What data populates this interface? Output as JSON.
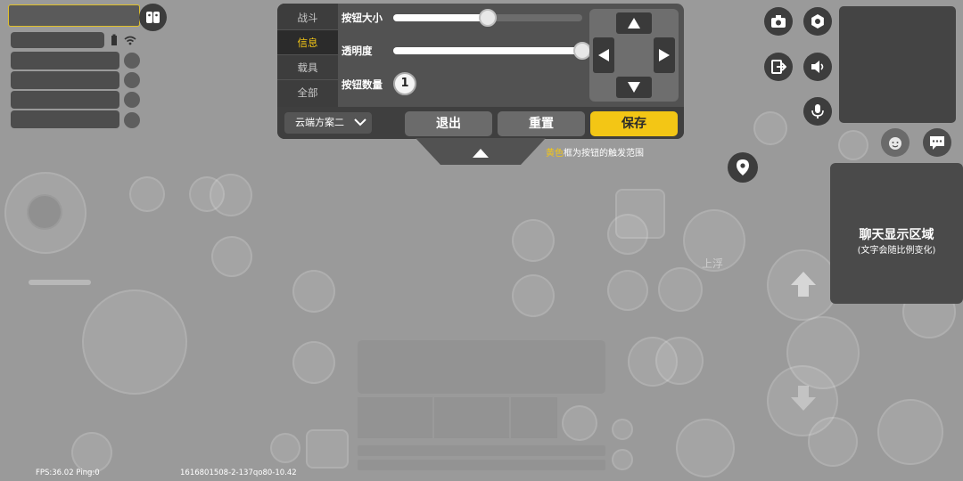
{
  "settings_panel": {
    "tabs": [
      {
        "label": "战斗",
        "active": false
      },
      {
        "label": "信息",
        "active": true
      },
      {
        "label": "载具",
        "active": false
      },
      {
        "label": "全部",
        "active": false
      }
    ],
    "button_size": {
      "label": "按钮大小",
      "value": 0.5
    },
    "opacity": {
      "label": "透明度",
      "value": 1.0
    },
    "button_count": {
      "label": "按钮数量",
      "value": "1"
    },
    "dpad_icons": [
      "arrow-up-icon",
      "arrow-down-icon",
      "arrow-left-icon",
      "arrow-right-icon"
    ],
    "scheme_select": {
      "value": "云端方案二"
    },
    "exit_label": "退出",
    "reset_label": "重置",
    "save_label": "保存"
  },
  "hint": {
    "highlight": "黄色",
    "rest": "框为按钮的触发范围"
  },
  "chat_area": {
    "title": "聊天显示区域",
    "subtitle": "(文字会随比例变化)"
  },
  "hud": {
    "float_label": "上浮",
    "fps_text": "FPS:36.02 Ping:0",
    "build_text": "1616801508-2-137qo80-10.42"
  },
  "right_icons": [
    "camera-icon",
    "settings-icon",
    "exit-vehicle-icon",
    "speaker-icon",
    "microphone-icon",
    "emote-icon",
    "chat-bubble-icon",
    "location-pin-icon"
  ],
  "colors": {
    "accent": "#f3c615",
    "panel": "#525252",
    "background": "#9a9a9a"
  }
}
